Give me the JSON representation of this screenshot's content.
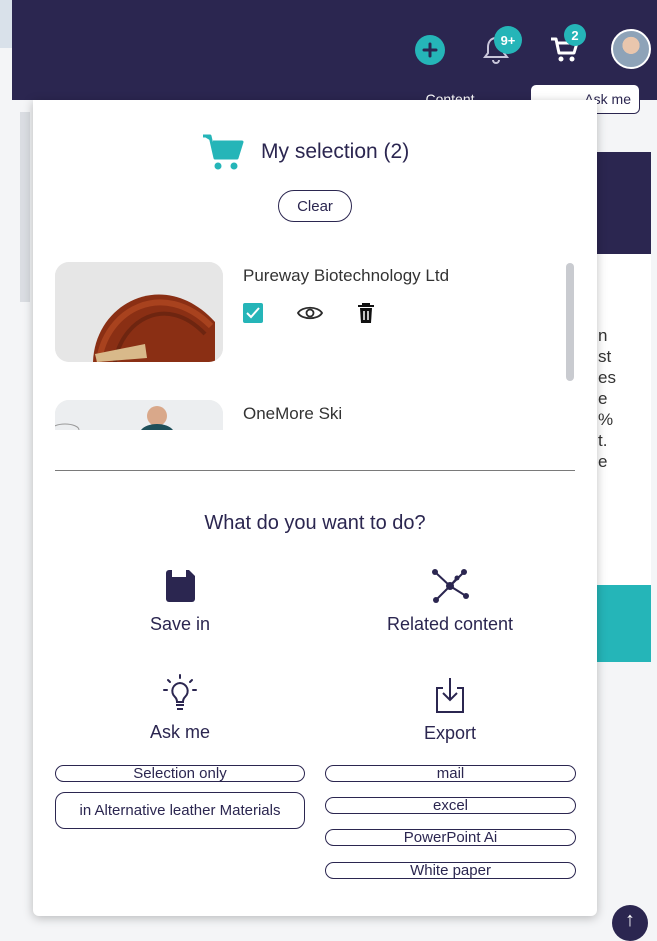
{
  "topbar": {
    "notifications_badge": "9+",
    "cart_badge": "2",
    "icons": [
      "plus-circle-icon",
      "bell-icon",
      "cart-icon",
      "user-avatar"
    ]
  },
  "background": {
    "content_tab": "Content",
    "ask_tab": "Ask me",
    "text_fragments": [
      "n",
      "st",
      "es",
      "e",
      "%",
      "t.",
      "e"
    ]
  },
  "selection": {
    "title": "My selection (2)",
    "clear_label": "Clear",
    "items": [
      {
        "name": "Pureway Biotechnology Ltd",
        "checked": true
      },
      {
        "name": "OneMore Ski"
      }
    ]
  },
  "actions": {
    "question": "What do you want to do?",
    "save_label": "Save in",
    "related_label": "Related content",
    "ask_label": "Ask me",
    "export_label": "Export"
  },
  "ask_options": [
    "Selection only",
    "in Alternative leather Materials"
  ],
  "export_options": [
    "mail",
    "excel",
    "PowerPoint Ai",
    "White paper"
  ],
  "colors": {
    "navy": "#2b2650",
    "teal": "#25b5b8"
  }
}
